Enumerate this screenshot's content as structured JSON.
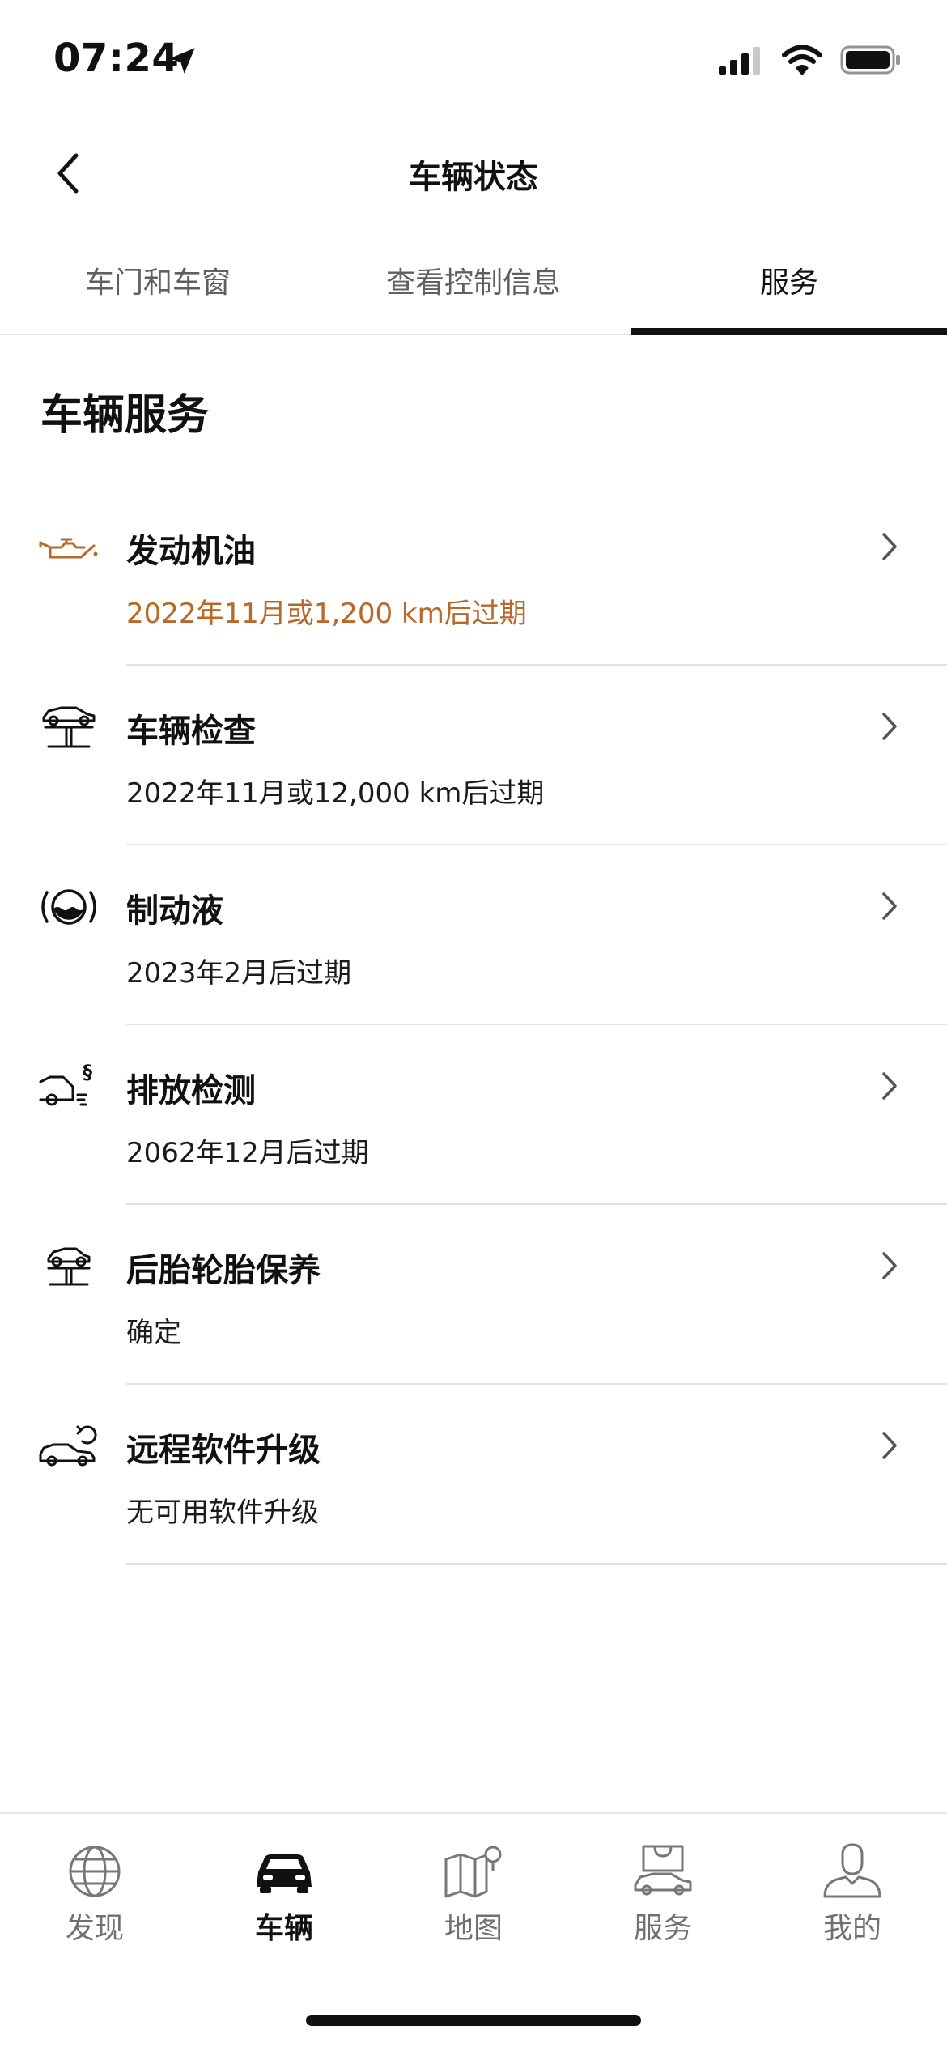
{
  "status_bar": {
    "time": "07:24"
  },
  "header": {
    "title": "车辆状态"
  },
  "tabs": [
    {
      "label": "车门和车窗",
      "active": false
    },
    {
      "label": "查看控制信息",
      "active": false
    },
    {
      "label": "服务",
      "active": true
    }
  ],
  "section": {
    "title": "车辆服务"
  },
  "services": [
    {
      "icon": "engine-oil-icon",
      "title": "发动机油",
      "subtitle": "2022年11月或1,200 km后过期",
      "warning": true
    },
    {
      "icon": "vehicle-lift-icon",
      "title": "车辆检查",
      "subtitle": "2022年11月或12,000 km后过期",
      "warning": false
    },
    {
      "icon": "brake-fluid-icon",
      "title": "制动液",
      "subtitle": "2023年2月后过期",
      "warning": false
    },
    {
      "icon": "emission-test-icon",
      "title": "排放检测",
      "subtitle": "2062年12月后过期",
      "warning": false
    },
    {
      "icon": "tire-service-icon",
      "title": "后胎轮胎保养",
      "subtitle": "确定",
      "warning": false
    },
    {
      "icon": "remote-software-upgrade-icon",
      "title": "远程软件升级",
      "subtitle": "无可用软件升级",
      "warning": false
    }
  ],
  "bottom_nav": [
    {
      "icon": "globe-icon",
      "label": "发现",
      "active": false
    },
    {
      "icon": "car-icon",
      "label": "车辆",
      "active": true
    },
    {
      "icon": "map-icon",
      "label": "地图",
      "active": false
    },
    {
      "icon": "shopping-car-icon",
      "label": "服务",
      "active": false
    },
    {
      "icon": "user-icon",
      "label": "我的",
      "active": false
    }
  ],
  "colors": {
    "warning": "#b8692a",
    "text": "#111111",
    "divider": "#e3e3e3"
  }
}
